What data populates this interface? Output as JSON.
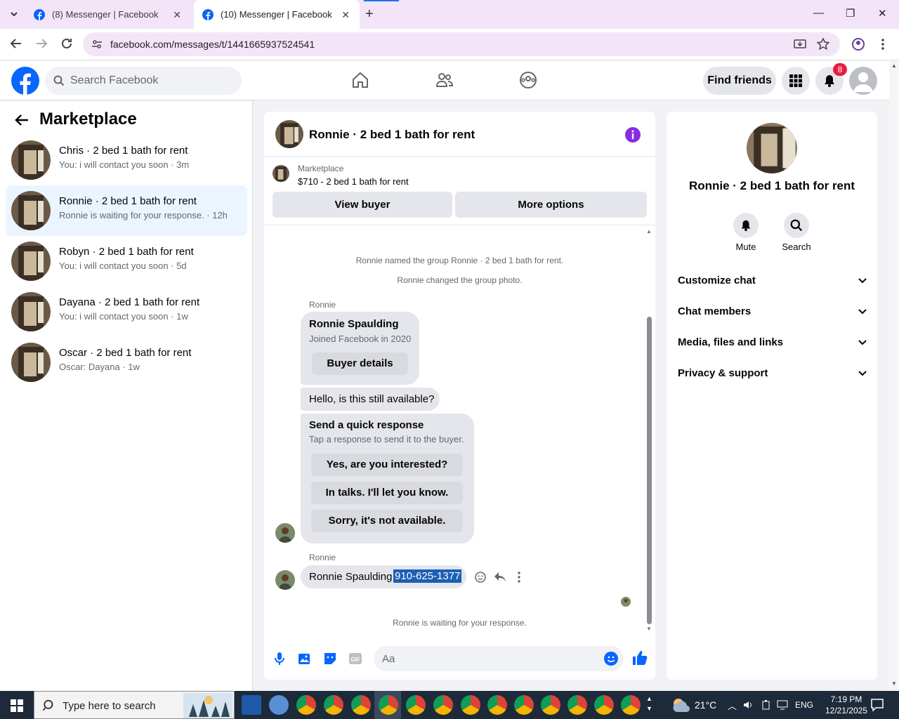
{
  "browser": {
    "tabs": [
      {
        "title": "(8) Messenger | Facebook",
        "active": false
      },
      {
        "title": "(10) Messenger | Facebook",
        "active": true
      }
    ],
    "url": "facebook.com/messages/t/1441665937524541"
  },
  "header": {
    "search_placeholder": "Search Facebook",
    "find_friends": "Find friends",
    "notification_count": "8"
  },
  "left": {
    "title": "Marketplace",
    "conversations": [
      {
        "title": "Chris · 2 bed 1 bath for rent",
        "snippet": "You: i will contact you soon · 3m"
      },
      {
        "title": "Ronnie · 2 bed 1 bath for rent",
        "snippet": "Ronnie is waiting for your response. · 12h"
      },
      {
        "title": "Robyn · 2 bed 1 bath for rent",
        "snippet": "You: i will contact you soon · 5d"
      },
      {
        "title": "Dayana · 2 bed 1 bath for rent",
        "snippet": "You: i will contact you soon · 1w"
      },
      {
        "title": "Oscar · 2 bed 1 bath for rent",
        "snippet": "Oscar: Dayana · 1w"
      }
    ]
  },
  "chat": {
    "title": "Ronnie · 2 bed 1 bath for rent",
    "listing_label": "Marketplace",
    "listing_price": "$710 - 2 bed 1 bath for rent",
    "view_buyer": "View buyer",
    "more_options": "More options",
    "sys1": "Ronnie named the group Ronnie · 2 bed 1 bath for rent.",
    "sys2": "Ronnie changed the group photo.",
    "sender": "Ronnie",
    "card_name": "Ronnie Spaulding",
    "card_sub": "Joined Facebook in 2020",
    "buyer_details": "Buyer details",
    "msg1": "Hello, is this still available?",
    "quick_title": "Send a quick response",
    "quick_sub": "Tap a response to send it to the buyer.",
    "quick_responses": [
      "Yes, are you interested?",
      "In talks. I'll let you know.",
      "Sorry, it's not available."
    ],
    "sender2": "Ronnie",
    "msg2_name": "Ronnie Spaulding",
    "msg2_phone": "910-625-1377",
    "waiting": "Ronnie is waiting for your response.",
    "composer_placeholder": "Aa"
  },
  "right": {
    "title": "Ronnie · 2 bed 1 bath for rent",
    "mute": "Mute",
    "search": "Search",
    "sections": [
      "Customize chat",
      "Chat members",
      "Media, files and links",
      "Privacy & support"
    ]
  },
  "taskbar": {
    "search_placeholder": "Type here to search",
    "temperature": "21°C",
    "lang": "ENG",
    "time": "7:19 PM",
    "date": "12/21/2025"
  },
  "colors": {
    "fb_blue": "#0866ff",
    "messenger_purple": "#8a2be2",
    "highlight": "#1a5fb4"
  }
}
